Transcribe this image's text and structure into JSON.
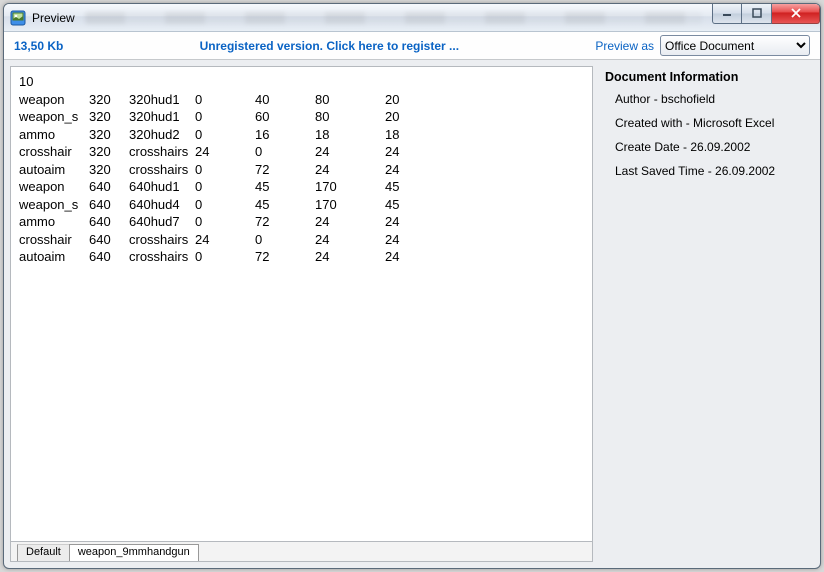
{
  "window": {
    "title": "Preview"
  },
  "infobar": {
    "filesize": "13,50 Kb",
    "register_link": "Unregistered version. Click here to register ...",
    "preview_as_label": "Preview as",
    "preview_as_selected": "Office Document"
  },
  "preview": {
    "first_line": "10",
    "columns": [
      "c0",
      "c1",
      "c2",
      "c3",
      "c4",
      "c5",
      "c6"
    ],
    "rows": [
      {
        "c0": "weapon",
        "c1": "320",
        "c2": "320hud1",
        "c3": "0",
        "c4": "40",
        "c5": "80",
        "c6": "20"
      },
      {
        "c0": "weapon_s",
        "c1": "320",
        "c2": "320hud1",
        "c3": "0",
        "c4": "60",
        "c5": "80",
        "c6": "20"
      },
      {
        "c0": "ammo",
        "c1": "320",
        "c2": "320hud2",
        "c3": "0",
        "c4": "16",
        "c5": "18",
        "c6": "18"
      },
      {
        "c0": "crosshair",
        "c1": "320",
        "c2": "crosshairs",
        "c3": "24",
        "c4": "0",
        "c5": "24",
        "c6": "24"
      },
      {
        "c0": "autoaim",
        "c1": "320",
        "c2": "crosshairs",
        "c3": "0",
        "c4": "72",
        "c5": "24",
        "c6": "24"
      },
      {
        "c0": "weapon",
        "c1": "640",
        "c2": "640hud1",
        "c3": "0",
        "c4": "45",
        "c5": "170",
        "c6": "45"
      },
      {
        "c0": "weapon_s",
        "c1": "640",
        "c2": "640hud4",
        "c3": "0",
        "c4": "45",
        "c5": "170",
        "c6": "45"
      },
      {
        "c0": "ammo",
        "c1": "640",
        "c2": "640hud7",
        "c3": "0",
        "c4": "72",
        "c5": "24",
        "c6": "24"
      },
      {
        "c0": "crosshair",
        "c1": "640",
        "c2": "crosshairs",
        "c3": "24",
        "c4": "0",
        "c5": "24",
        "c6": "24"
      },
      {
        "c0": "autoaim",
        "c1": "640",
        "c2": "crosshairs",
        "c3": "0",
        "c4": "72",
        "c5": "24",
        "c6": "24"
      }
    ],
    "tabs": [
      {
        "label": "Default",
        "active": false
      },
      {
        "label": "weapon_9mmhandgun",
        "active": true
      }
    ]
  },
  "doc_info": {
    "heading": "Document Information",
    "items": [
      {
        "label": "Author",
        "value": "bschofield"
      },
      {
        "label": "Created with",
        "value": "Microsoft Excel"
      },
      {
        "label": "Create Date",
        "value": "26.09.2002"
      },
      {
        "label": "Last Saved Time",
        "value": "26.09.2002"
      }
    ]
  }
}
